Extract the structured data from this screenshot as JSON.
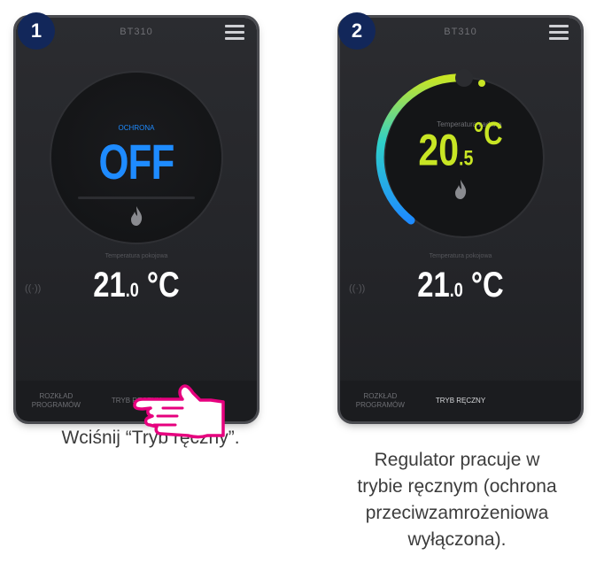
{
  "steps": [
    {
      "number": "1",
      "header_title": "BT310",
      "dial_label": "OCHRONA",
      "mode_value": "OFF",
      "room_label": "Temperatura pokojowa",
      "room_temp_whole": "21",
      "room_temp_dec": ".0",
      "room_temp_unit": "°C",
      "bottom_tabs": [
        "ROZKŁAD PROGRAMÓW",
        "TRYB RĘCZNY",
        ""
      ],
      "caption": "Wciśnij “Tryb ręczny”."
    },
    {
      "number": "2",
      "header_title": "BT310",
      "dial_label": "Temperatura zadana",
      "set_temp_whole": "20",
      "set_temp_dec": ".5",
      "set_temp_unit": "°C",
      "room_label": "Temperatura pokojowa",
      "room_temp_whole": "21",
      "room_temp_dec": ".0",
      "room_temp_unit": "°C",
      "bottom_tabs": [
        "ROZKŁAD PROGRAMÓW",
        "TRYB RĘCZNY",
        ""
      ],
      "caption_lines": [
        "Regulator pracuje w",
        "trybie ręcznym (ochrona",
        "przeciwzamrożeniowa",
        "wyłączona)."
      ]
    }
  ],
  "colors": {
    "badge": "#12275a",
    "off_blue": "#1e8bff",
    "set_temp_yellow": "#c8e524",
    "hand_pink": "#e6007e",
    "ring_gradient": [
      "#c8e524",
      "#2fd0c8",
      "#1e8bff"
    ]
  },
  "icons": [
    "menu-icon",
    "flame-icon",
    "wifi-signal-icon",
    "pointing-hand-icon"
  ]
}
